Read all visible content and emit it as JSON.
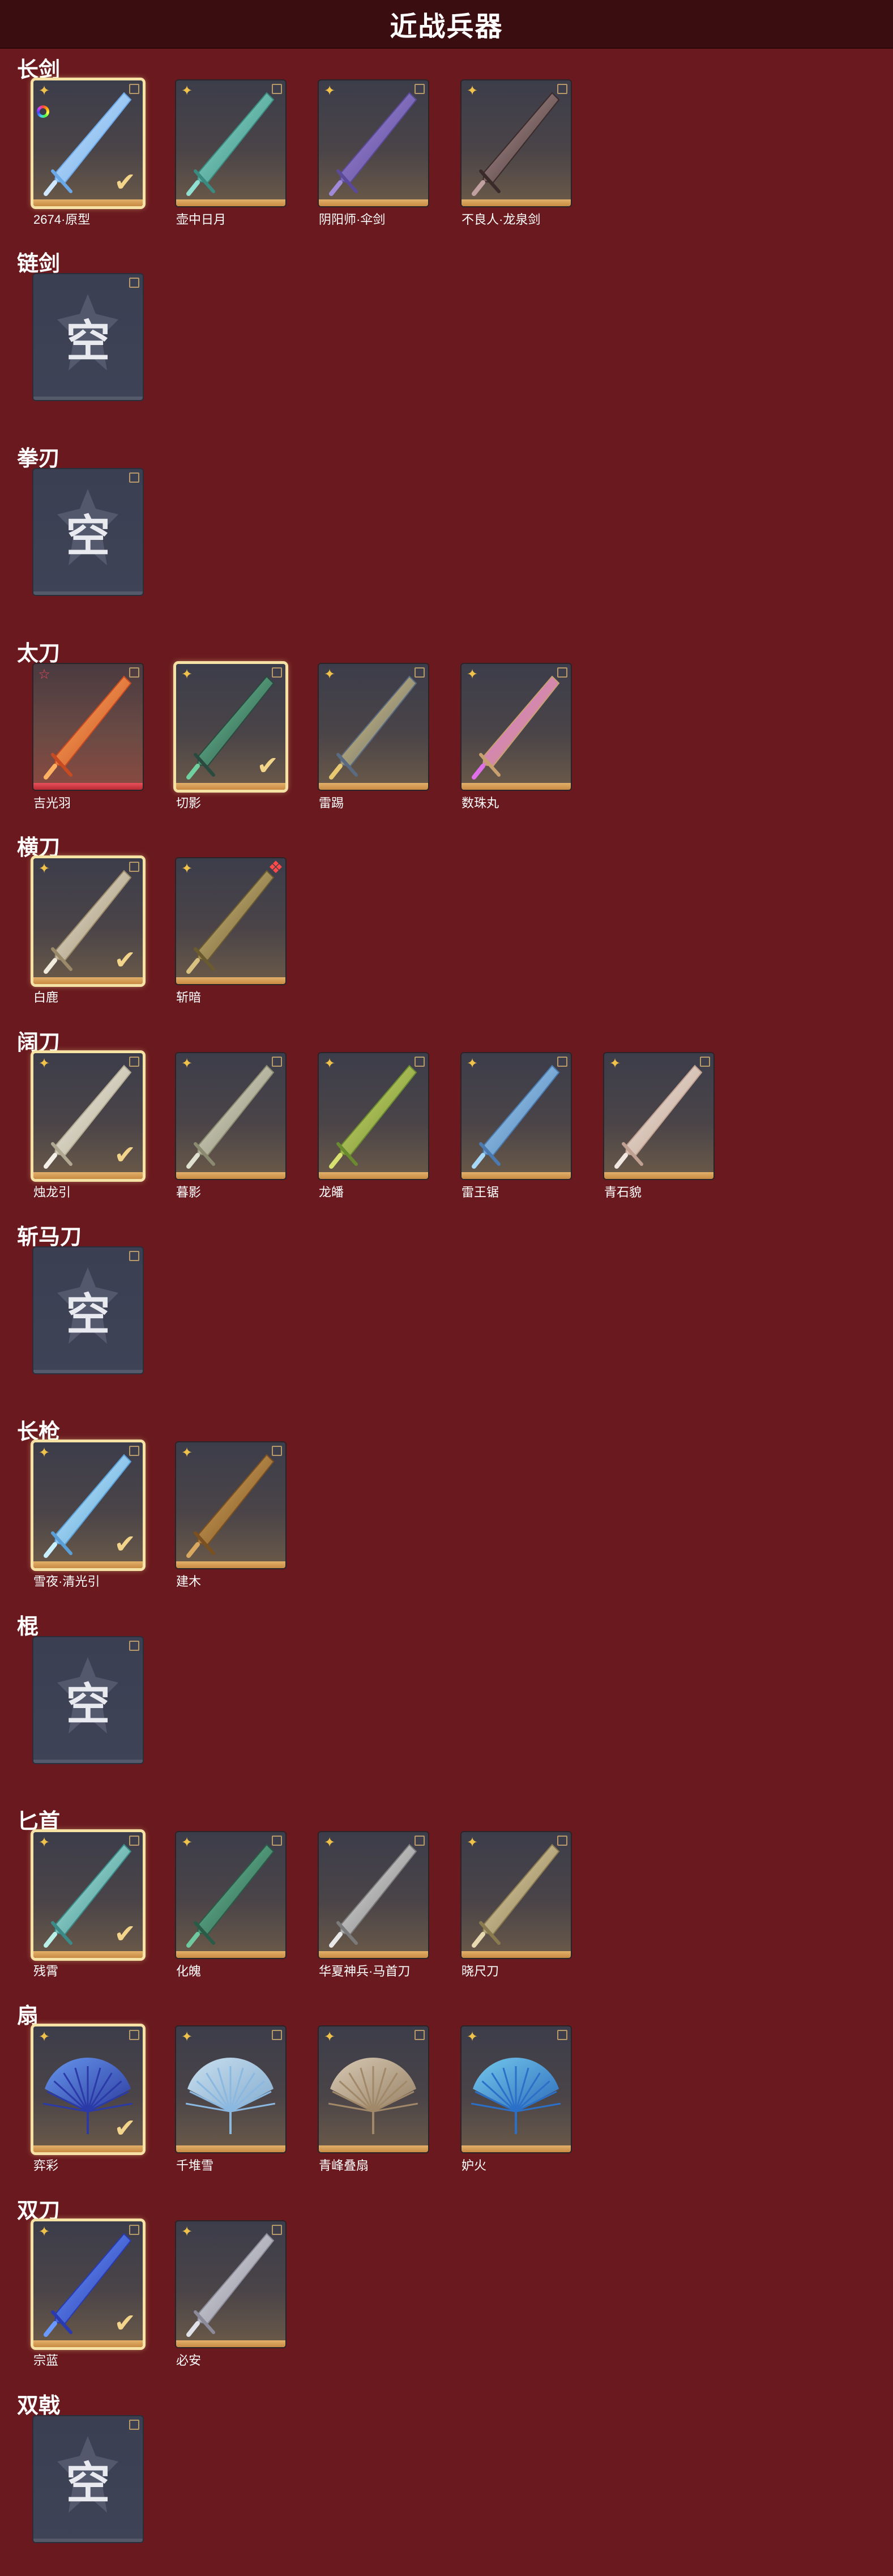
{
  "header": {
    "title": "近战兵器"
  },
  "colors": {
    "background": "#6a1a1e",
    "header": "#3a0d10",
    "gold": "#e2b06a",
    "selected_border": "#f7e2a6"
  },
  "sections": [
    {
      "title": "长剑",
      "items": [
        {
          "label": "2674·原型",
          "selected": true,
          "badge": "rainbow",
          "art": "glow-sword"
        },
        {
          "label": "壶中日月",
          "selected": false,
          "badge": "gold",
          "art": "jade-sword"
        },
        {
          "label": "阴阳师·伞剑",
          "selected": false,
          "badge": "gold",
          "art": "umbrella-sword"
        },
        {
          "label": "不良人·龙泉剑",
          "selected": false,
          "badge": "gold",
          "art": "dark-sword"
        }
      ]
    },
    {
      "title": "链剑",
      "items": [
        {
          "label": "",
          "empty": true,
          "empty_char": "空"
        }
      ]
    },
    {
      "title": "拳刃",
      "items": [
        {
          "label": "",
          "empty": true,
          "empty_char": "空"
        }
      ]
    },
    {
      "title": "太刀",
      "items": [
        {
          "label": "吉光羽",
          "selected": false,
          "badge": "red",
          "red": true,
          "art": "fire-katana"
        },
        {
          "label": "切影",
          "selected": true,
          "badge": "gold",
          "art": "green-katana"
        },
        {
          "label": "雷踢",
          "selected": false,
          "badge": "gold",
          "art": "gold-katana"
        },
        {
          "label": "数珠丸",
          "selected": false,
          "badge": "gold",
          "art": "purple-katana"
        }
      ]
    },
    {
      "title": "横刀",
      "items": [
        {
          "label": "白鹿",
          "selected": true,
          "badge": "gold",
          "art": "white-sabre"
        },
        {
          "label": "斩暗",
          "selected": false,
          "badge": "gold",
          "corner_red": true,
          "art": "bronze-sabre"
        }
      ]
    },
    {
      "title": "阔刀",
      "items": [
        {
          "label": "烛龙引",
          "selected": true,
          "badge": "gold",
          "art": "white-broadsword"
        },
        {
          "label": "暮影",
          "selected": false,
          "badge": "gold",
          "art": "grey-broadsword"
        },
        {
          "label": "龙皤",
          "selected": false,
          "badge": "gold",
          "art": "green-broadsword"
        },
        {
          "label": "雷王锯",
          "selected": false,
          "badge": "gold",
          "art": "blue-broadsword"
        },
        {
          "label": "青石貌",
          "selected": false,
          "badge": "gold",
          "art": "pale-broadsword"
        }
      ]
    },
    {
      "title": "斩马刀",
      "items": [
        {
          "label": "",
          "empty": true,
          "empty_char": "空"
        }
      ]
    },
    {
      "title": "长枪",
      "items": [
        {
          "label": "雪夜·清光引",
          "selected": true,
          "badge": "gold",
          "art": "ice-spear"
        },
        {
          "label": "建木",
          "selected": false,
          "badge": "gold",
          "art": "wood-spear"
        }
      ]
    },
    {
      "title": "棍",
      "items": [
        {
          "label": "",
          "empty": true,
          "empty_char": "空"
        }
      ]
    },
    {
      "title": "匕首",
      "items": [
        {
          "label": "残霄",
          "selected": true,
          "badge": "gold",
          "art": "teal-dagger"
        },
        {
          "label": "化魄",
          "selected": false,
          "badge": "gold",
          "art": "green-dagger"
        },
        {
          "label": "华夏神兵·马首刀",
          "selected": false,
          "badge": "gold",
          "art": "steel-dagger"
        },
        {
          "label": "晓尺刀",
          "selected": false,
          "badge": "gold",
          "art": "bone-dagger"
        }
      ]
    },
    {
      "title": "扇",
      "items": [
        {
          "label": "弈彩",
          "selected": true,
          "badge": "gold",
          "art": "blue-fan"
        },
        {
          "label": "千堆雪",
          "selected": false,
          "badge": "gold",
          "art": "ice-fan"
        },
        {
          "label": "青峰叠扇",
          "selected": false,
          "badge": "gold",
          "art": "paper-fan"
        },
        {
          "label": "妒火",
          "selected": false,
          "badge": "gold",
          "art": "feather-fan"
        }
      ]
    },
    {
      "title": "双刀",
      "items": [
        {
          "label": "宗蓝",
          "selected": true,
          "badge": "gold",
          "art": "blue-twin"
        },
        {
          "label": "必安",
          "selected": false,
          "badge": "gold",
          "art": "silver-twin"
        }
      ]
    },
    {
      "title": "双戟",
      "items": [
        {
          "label": "",
          "empty": true,
          "empty_char": "空"
        }
      ]
    }
  ]
}
